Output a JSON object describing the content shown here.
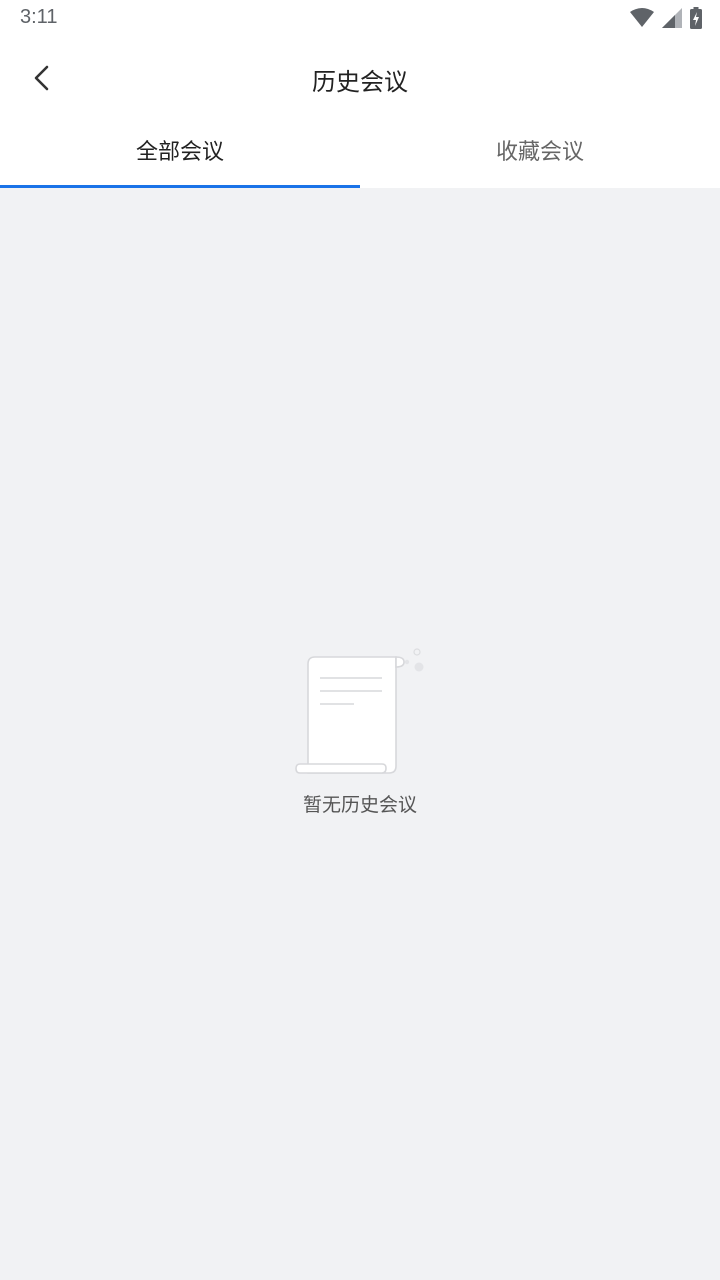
{
  "status_bar": {
    "time": "3:11",
    "icons": [
      "wifi-icon",
      "cell-signal-icon",
      "battery-charging-icon"
    ]
  },
  "header": {
    "title": "历史会议",
    "back_icon": "chevron-left-icon"
  },
  "tabs": [
    {
      "label": "全部会议",
      "active": true
    },
    {
      "label": "收藏会议",
      "active": false
    }
  ],
  "empty_state": {
    "icon": "document-scroll-icon",
    "message": "暂无历史会议"
  },
  "colors": {
    "accent": "#1a73e8",
    "background": "#f1f2f4",
    "surface": "#ffffff"
  }
}
